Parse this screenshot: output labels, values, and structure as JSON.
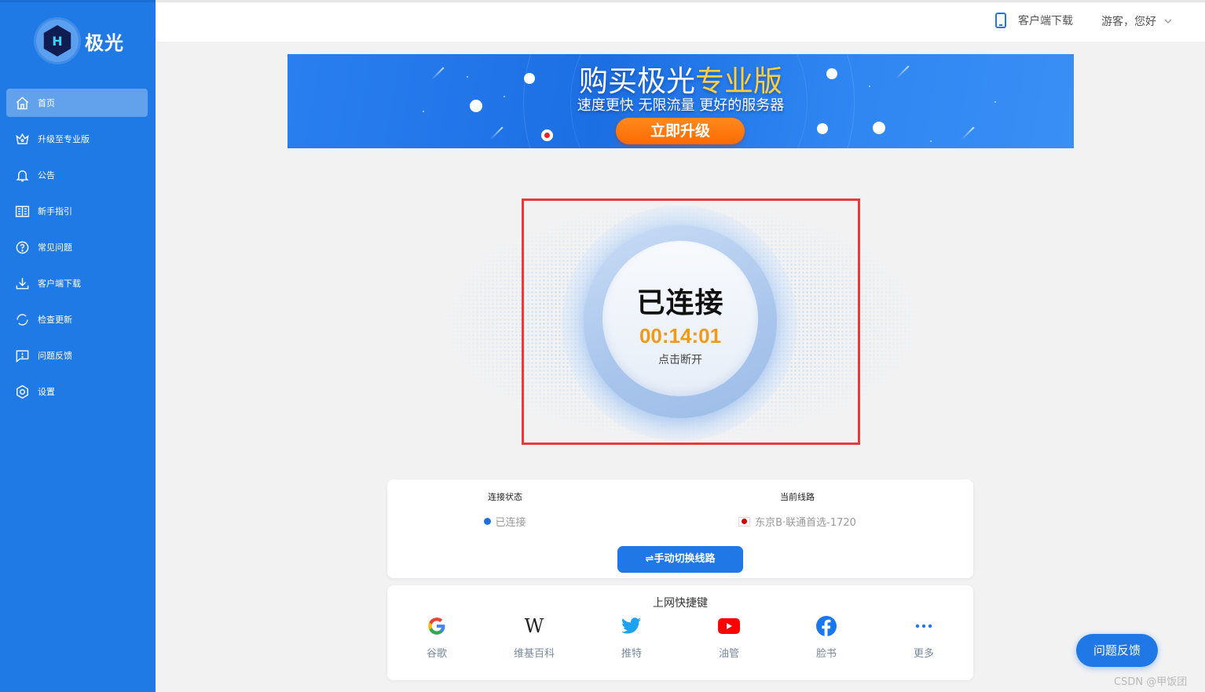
{
  "app": {
    "name": "极光",
    "logo_glyph": "H"
  },
  "sidebar": {
    "items": [
      {
        "label": "首页",
        "icon": "home-icon",
        "active": true
      },
      {
        "label": "升级至专业版",
        "icon": "crown-icon",
        "active": false
      },
      {
        "label": "公告",
        "icon": "bell-icon",
        "active": false
      },
      {
        "label": "新手指引",
        "icon": "book-icon",
        "active": false
      },
      {
        "label": "常见问题",
        "icon": "question-icon",
        "active": false
      },
      {
        "label": "客户端下载",
        "icon": "download-icon",
        "active": false
      },
      {
        "label": "检查更新",
        "icon": "refresh-icon",
        "active": false
      },
      {
        "label": "问题反馈",
        "icon": "feedback-icon",
        "active": false
      },
      {
        "label": "设置",
        "icon": "gear-icon",
        "active": false
      }
    ]
  },
  "topbar": {
    "download_label": "客户端下载",
    "user_label": "游客，您好"
  },
  "banner": {
    "title_main": "购买极光",
    "title_highlight": "专业版",
    "subtitle": "速度更快 无限流量 更好的服务器",
    "button_label": "立即升级"
  },
  "connection": {
    "status_title": "已连接",
    "timer": "00:14:01",
    "hint": "点击断开"
  },
  "info": {
    "status_label": "连接状态",
    "status_value": "已连接",
    "line_label": "当前线路",
    "line_value": "东京B·联通首选-1720",
    "switch_button": "⇌手动切换线路"
  },
  "shortcuts": {
    "title": "上网快捷键",
    "items": [
      {
        "label": "谷歌",
        "icon": "google-icon"
      },
      {
        "label": "维基百科",
        "icon": "wikipedia-icon"
      },
      {
        "label": "推特",
        "icon": "twitter-icon"
      },
      {
        "label": "油管",
        "icon": "youtube-icon"
      },
      {
        "label": "脸书",
        "icon": "facebook-icon"
      },
      {
        "label": "更多",
        "icon": "more-icon"
      }
    ]
  },
  "feedback_button": "问题反馈",
  "watermark": "CSDN @甲饭团",
  "colors": {
    "primary": "#1f7ae6",
    "accent_orange": "#f19a1a",
    "banner_button": "#ff7a10",
    "highlight_border": "#e8393b"
  }
}
